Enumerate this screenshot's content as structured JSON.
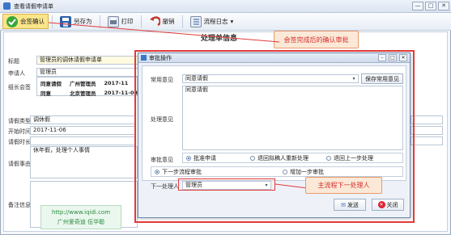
{
  "window": {
    "title": "查看请假申请单",
    "min": "—",
    "max": "□",
    "close": "✕"
  },
  "toolbar": {
    "items": [
      {
        "label": "会签确认",
        "icon": "check-icon"
      },
      {
        "label": "另存为",
        "icon": "save-icon"
      },
      {
        "label": "打印",
        "icon": "print-icon"
      },
      {
        "label": "撤销",
        "icon": "undo-icon"
      },
      {
        "label": "流程日志",
        "icon": "log-icon"
      }
    ],
    "log_arrow": "▾"
  },
  "form": {
    "section_title": "处理单信息",
    "title_label": "标题",
    "title_value": "管理员的调休请假申请单",
    "applicant_label": "申请人",
    "applicant_value": "管理员",
    "countersign_label": "组长会签",
    "countersign_rows": [
      [
        "同意请假",
        "广州管理员",
        "2017-11"
      ],
      [
        "同意",
        "北京管理员",
        "2017-11-03"
      ]
    ],
    "leave_type_label": "请假类型",
    "leave_type_value": "调休假",
    "start_label": "开始时间",
    "start_value": "2017-11-06",
    "duration_label": "请假时长",
    "reason_label": "请假事由",
    "reason_value": "休年假，处理个人事情",
    "remark_label": "备注信息"
  },
  "dialog": {
    "title": "审批操作",
    "common_opinion_label": "常用意见",
    "common_opinion_value": "同意请假",
    "save_common_btn": "保存常用意见",
    "opinion_label": "处理意见",
    "opinion_value": "同意请假",
    "approval_label": "审批意见",
    "approval_options": [
      "批准申请",
      "退回拟稿人重新处理",
      "退回上一步处理"
    ],
    "flow_options": [
      "下一步流程审批",
      "增加一步审批"
    ],
    "next_handler_label": "下一处理人",
    "next_handler_value": "管理员",
    "send_btn": "发送",
    "close_btn": "关闭"
  },
  "annotations": {
    "callout_top": "会签完成后的确认审批",
    "callout_bottom": "主流程下一处理人"
  },
  "watermark": {
    "line1": "http://www.iqidi.com",
    "line2": "广州爱奇迪 伍华聪"
  },
  "colors": {
    "accent": "#1b5db5",
    "highlight": "#e23a3a",
    "callout_bg": "#fbe8d6"
  }
}
